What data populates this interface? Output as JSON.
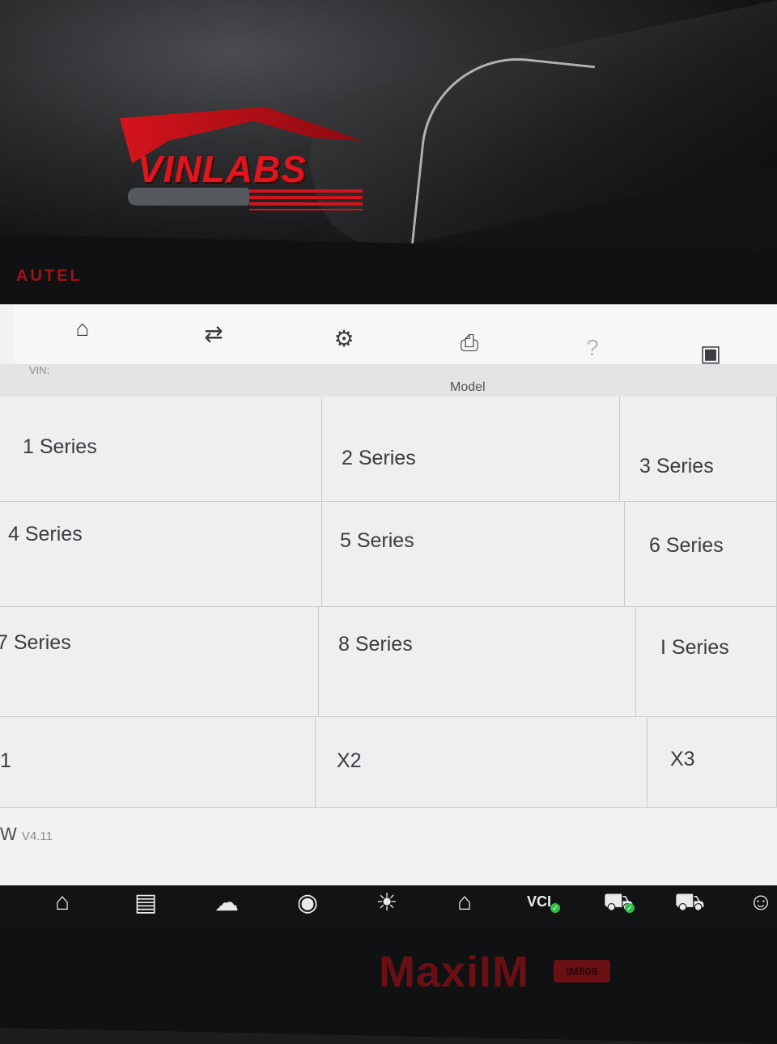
{
  "watermark": {
    "logo_text": "VINLABS"
  },
  "device": {
    "brand": "AUTEL",
    "model_name": "MaxiIM",
    "model_badge": "IM608"
  },
  "toolbar": {
    "items": [
      {
        "icon": "home-icon",
        "glyph": "⌂"
      },
      {
        "icon": "vehicle-swap-icon",
        "glyph": "⇄"
      },
      {
        "icon": "gear-icon",
        "glyph": "⚙"
      },
      {
        "icon": "printer-icon",
        "glyph": "⎙"
      },
      {
        "icon": "help-icon",
        "glyph": "?"
      },
      {
        "icon": "save-icon",
        "glyph": "▣"
      }
    ]
  },
  "vin": {
    "label": "VIN:"
  },
  "model_header": "Model",
  "models": [
    "1 Series",
    "2 Series",
    "3 Series",
    "4 Series",
    "5 Series",
    "6 Series",
    "7 Series",
    "8 Series",
    "I Series",
    "1",
    "X2",
    "X3"
  ],
  "footer": {
    "app_fragment": "W",
    "version": "V4.11"
  },
  "taskbar": {
    "items": [
      {
        "icon": "home-icon",
        "glyph": "⌂"
      },
      {
        "icon": "recent-apps-icon",
        "glyph": "▤"
      },
      {
        "icon": "cloud-icon",
        "glyph": "☁"
      },
      {
        "icon": "camera-icon",
        "glyph": "◉"
      },
      {
        "icon": "brightness-volume-icon",
        "glyph": "☀"
      },
      {
        "icon": "shop-icon",
        "glyph": "⌂"
      },
      {
        "icon": "vci-icon",
        "glyph": "VCI"
      },
      {
        "icon": "vehicle-connected-icon",
        "glyph": "⛟"
      },
      {
        "icon": "car-icon",
        "glyph": "⛟"
      },
      {
        "icon": "technician-icon",
        "glyph": "☺"
      }
    ]
  }
}
